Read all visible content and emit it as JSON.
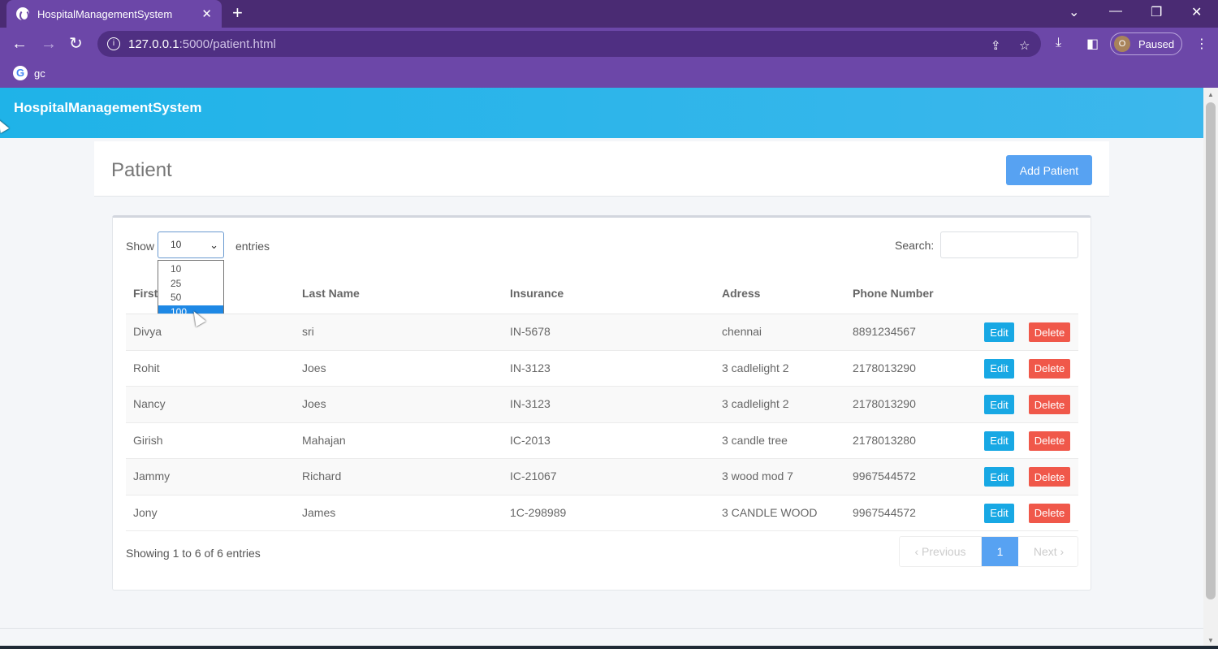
{
  "browser": {
    "tab_title": "HospitalManagementSystem",
    "tab_close": "✕",
    "new_tab": "+",
    "url_host": "127.0.0.1",
    "url_path": ":5000/patient.html",
    "profile_initial": "O",
    "profile_status": "Paused",
    "bookmark_label": "gc"
  },
  "app": {
    "brand": "HospitalManagementSystem"
  },
  "header": {
    "title": "Patient",
    "add_button": "Add Patient"
  },
  "table_controls": {
    "show_label": "Show",
    "entries_label": "entries",
    "selected_length": "10",
    "length_options": [
      "10",
      "25",
      "50",
      "100"
    ],
    "highlighted_option": "100",
    "search_label": "Search:",
    "search_value": ""
  },
  "columns": [
    "First",
    "Last Name",
    "Insurance",
    "Adress",
    "Phone Number"
  ],
  "rows": [
    {
      "first": "Divya",
      "last": "sri",
      "insurance": "IN-5678",
      "address": "chennai",
      "phone": "8891234567"
    },
    {
      "first": "Rohit",
      "last": "Joes",
      "insurance": "IN-3123",
      "address": "3 cadlelight 2",
      "phone": "2178013290"
    },
    {
      "first": "Nancy",
      "last": "Joes",
      "insurance": "IN-3123",
      "address": "3 cadlelight 2",
      "phone": "2178013290"
    },
    {
      "first": "Girish",
      "last": "Mahajan",
      "insurance": "IC-2013",
      "address": "3 candle tree",
      "phone": "2178013280"
    },
    {
      "first": "Jammy",
      "last": "Richard",
      "insurance": "IC-21067",
      "address": "3 wood mod 7",
      "phone": "9967544572"
    },
    {
      "first": "Jony",
      "last": "James",
      "insurance": "1C-298989",
      "address": "3 CANDLE WOOD",
      "phone": "9967544572"
    }
  ],
  "row_actions": {
    "edit": "Edit",
    "delete": "Delete"
  },
  "footer": {
    "info": "Showing 1 to 6 of 6 entries",
    "prev": "‹  Previous",
    "current_page": "1",
    "next": "Next  ›"
  },
  "colors": {
    "appbar": "#1fb3e8",
    "primary": "#57a2f2",
    "edit": "#18a8e4",
    "delete": "#f0584a",
    "chrome": "#6c47a8"
  }
}
